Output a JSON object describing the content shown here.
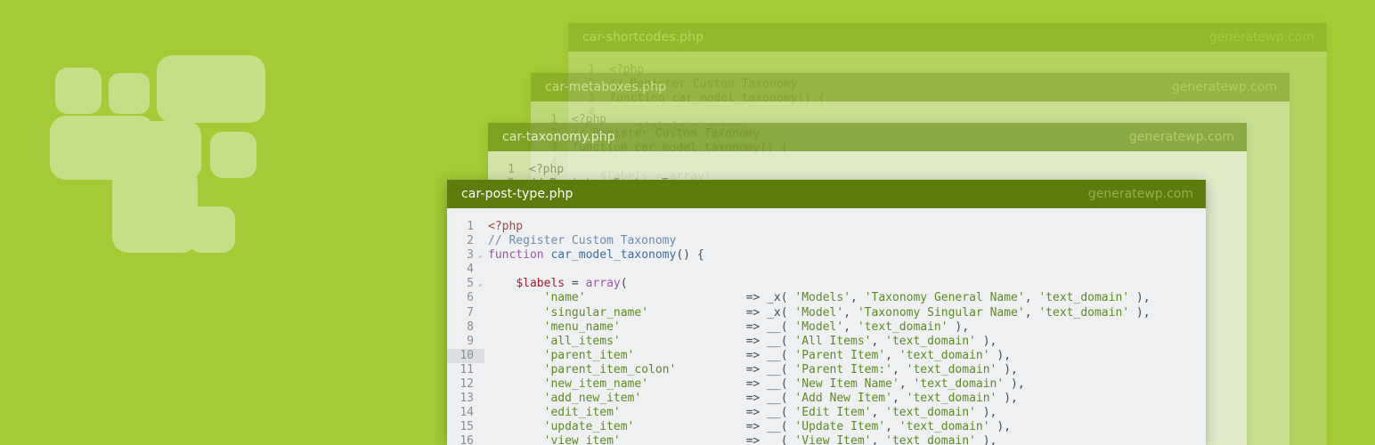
{
  "logo": {
    "name": "generatewp-logo"
  },
  "windows": [
    {
      "title": "car-shortcodes.php",
      "brand": "generatewp.com"
    },
    {
      "title": "car-metaboxes.php",
      "brand": "generatewp.com"
    },
    {
      "title": "car-taxonomy.php",
      "brand": "generatewp.com"
    },
    {
      "title": "car-post-type.php",
      "brand": "generatewp.com"
    }
  ],
  "code": {
    "active_line": 10,
    "lines": [
      {
        "n": "1",
        "text": "<?php"
      },
      {
        "n": "2",
        "text": "// Register Custom Taxonomy"
      },
      {
        "n": "3",
        "text": "function car_model_taxonomy() {"
      },
      {
        "n": "4",
        "text": ""
      },
      {
        "n": "5",
        "text": "    $labels = array("
      },
      {
        "n": "6",
        "text": "        'name'                       => _x( 'Models', 'Taxonomy General Name', 'text_domain' ),"
      },
      {
        "n": "7",
        "text": "        'singular_name'              => _x( 'Model', 'Taxonomy Singular Name', 'text_domain' ),"
      },
      {
        "n": "8",
        "text": "        'menu_name'                  => __( 'Model', 'text_domain' ),"
      },
      {
        "n": "9",
        "text": "        'all_items'                  => __( 'All Items', 'text_domain' ),"
      },
      {
        "n": "10",
        "text": "        'parent_item'                => __( 'Parent Item', 'text_domain' ),"
      },
      {
        "n": "11",
        "text": "        'parent_item_colon'          => __( 'Parent Item:', 'text_domain' ),"
      },
      {
        "n": "12",
        "text": "        'new_item_name'              => __( 'New Item Name', 'text_domain' ),"
      },
      {
        "n": "13",
        "text": "        'add_new_item'               => __( 'Add New Item', 'text_domain' ),"
      },
      {
        "n": "14",
        "text": "        'edit_item'                  => __( 'Edit Item', 'text_domain' ),"
      },
      {
        "n": "15",
        "text": "        'update_item'                => __( 'Update Item', 'text_domain' ),"
      },
      {
        "n": "16",
        "text": "        'view_item'                  => __( 'View Item', 'text_domain' ),"
      }
    ]
  },
  "bg_code": [
    {
      "n": "1",
      "text": "<?php"
    },
    {
      "n": "2",
      "text": "// Register Custom Taxonomy"
    },
    {
      "n": "3",
      "text": "function car_model_taxonomy() {"
    },
    {
      "n": "4",
      "text": ""
    },
    {
      "n": "5",
      "text": "    $labels = array("
    }
  ],
  "colors": {
    "background": "#a2cb36",
    "header": "#5c7d0c",
    "editor_bg": "#eef0f2",
    "logo": "#c4df86"
  }
}
